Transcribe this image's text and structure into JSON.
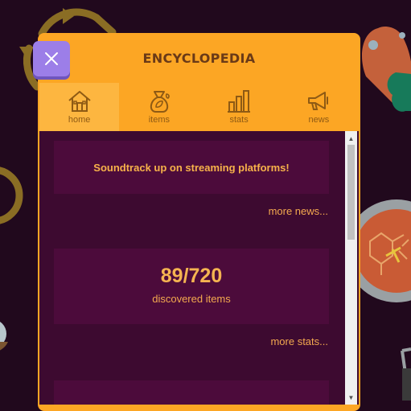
{
  "modal": {
    "title": "ENCYCLOPEDIA"
  },
  "tabs": [
    {
      "label": "home",
      "icon": "house-icon",
      "active": true
    },
    {
      "label": "items",
      "icon": "bag-icon",
      "active": false
    },
    {
      "label": "stats",
      "icon": "bar-chart-icon",
      "active": false
    },
    {
      "label": "news",
      "icon": "megaphone-icon",
      "active": false
    }
  ],
  "news": {
    "headline": "Soundtrack up on streaming platforms!",
    "more_link": "more news..."
  },
  "stats": {
    "discovered": "89/720",
    "label": "discovered items",
    "more_link": "more stats..."
  },
  "colors": {
    "modal_bg": "#fca624",
    "content_bg": "#3d0a30",
    "card_bg": "#4c0b3b",
    "close_button": "#9c7ee8",
    "page_bg": "#21091d"
  }
}
